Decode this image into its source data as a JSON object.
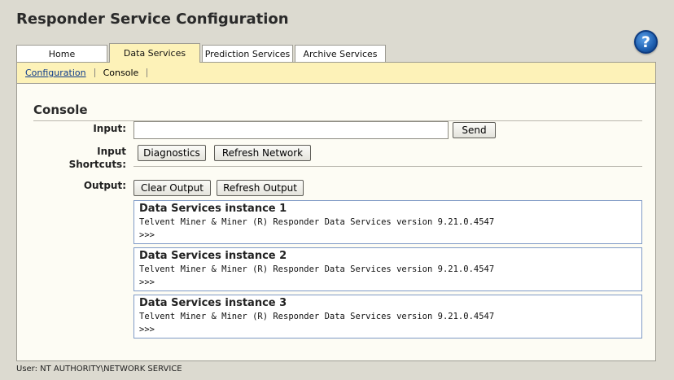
{
  "app": {
    "title": "Responder Service Configuration",
    "help_label": "?"
  },
  "tabs": [
    {
      "label": "Home"
    },
    {
      "label": "Data Services",
      "active": true
    },
    {
      "label": "Prediction Services"
    },
    {
      "label": "Archive Services"
    }
  ],
  "subnav": {
    "configuration": "Configuration",
    "console": "Console"
  },
  "console": {
    "title": "Console",
    "input_label": "Input:",
    "input_value": "",
    "send": "Send",
    "shortcuts_label_1": "Input",
    "shortcuts_label_2": "Shortcuts:",
    "diagnostics": "Diagnostics",
    "refresh_network": "Refresh Network",
    "output_label": "Output:",
    "clear_output": "Clear Output",
    "refresh_output": "Refresh Output",
    "outputs": [
      {
        "title": "Data Services instance 1",
        "line": "Telvent Miner & Miner (R) Responder Data Services version 9.21.0.4547",
        "prompt": ">>>"
      },
      {
        "title": "Data Services instance 2",
        "line": "Telvent Miner & Miner (R) Responder Data Services version 9.21.0.4547",
        "prompt": ">>>"
      },
      {
        "title": "Data Services instance 3",
        "line": "Telvent Miner & Miner (R) Responder Data Services version 9.21.0.4547",
        "prompt": ">>>"
      }
    ]
  },
  "footer": {
    "user": "User: NT AUTHORITY\\NETWORK SERVICE"
  },
  "colors": {
    "tab_active": "#fdf2b8",
    "background": "#dcdad0",
    "panel": "#fdfcf4",
    "output_border": "#7f9ac6"
  }
}
